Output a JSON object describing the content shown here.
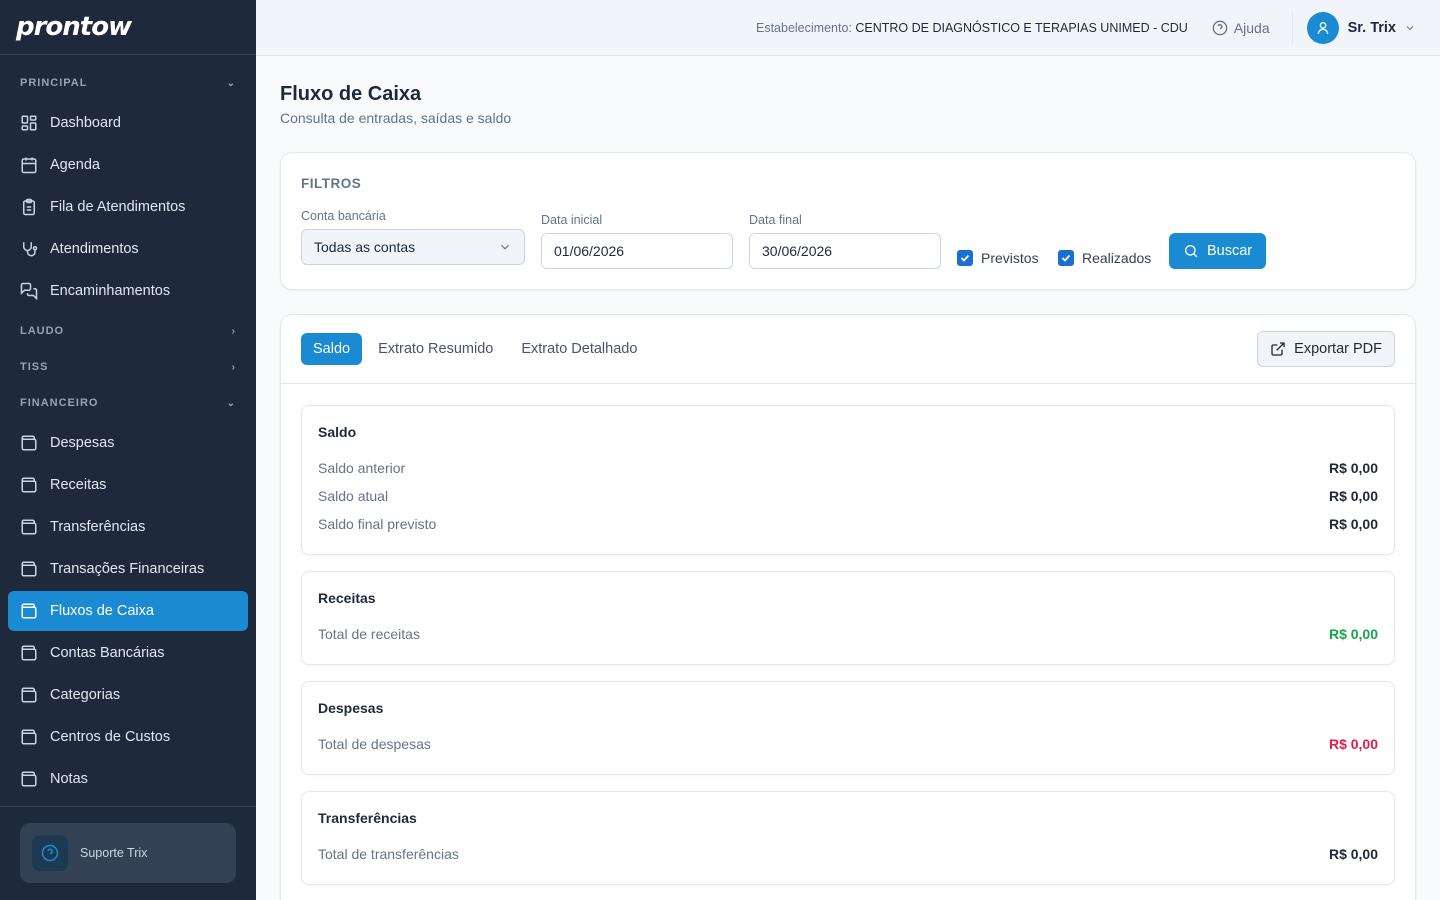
{
  "app": {
    "logo": "prontow"
  },
  "topbar": {
    "estab_label": "Estabelecimento:",
    "estab_value": "CENTRO DE DIAGNÓSTICO E TERAPIAS UNIMED - CDU",
    "help": "Ajuda",
    "user_name": "Sr. Trix"
  },
  "sidebar": {
    "sections": {
      "principal": "PRINCIPAL",
      "laudo": "LAUDO",
      "tiss": "TISS",
      "financeiro": "FINANCEIRO"
    },
    "principal_items": [
      "Dashboard",
      "Agenda",
      "Fila de Atendimentos",
      "Atendimentos",
      "Encaminhamentos"
    ],
    "financeiro_items": [
      "Despesas",
      "Receitas",
      "Transferências",
      "Transações Financeiras",
      "Fluxos de Caixa",
      "Contas Bancárias",
      "Categorias",
      "Centros de Custos",
      "Notas"
    ],
    "support": "Suporte Trix"
  },
  "page": {
    "title": "Fluxo de Caixa",
    "subtitle": "Consulta de entradas, saídas e saldo"
  },
  "filters": {
    "title": "FILTROS",
    "account_label": "Conta bancária",
    "account_value": "Todas as contas",
    "start_label": "Data inicial",
    "start_value": "01/06/2026",
    "end_label": "Data final",
    "end_value": "30/06/2026",
    "previstos": "Previstos",
    "realizados": "Realizados",
    "search": "Buscar"
  },
  "tabs": [
    "Saldo",
    "Extrato Resumido",
    "Extrato Detalhado"
  ],
  "export": "Exportar PDF",
  "saldo": {
    "title": "Saldo",
    "rows": [
      {
        "label": "Saldo anterior",
        "value": "R$ 0,00"
      },
      {
        "label": "Saldo atual",
        "value": "R$ 0,00"
      },
      {
        "label": "Saldo final previsto",
        "value": "R$ 0,00"
      }
    ]
  },
  "receitas": {
    "title": "Receitas",
    "label": "Total de receitas",
    "value": "R$ 0,00"
  },
  "despesas": {
    "title": "Despesas",
    "label": "Total de despesas",
    "value": "R$ 0,00"
  },
  "transferencias": {
    "title": "Transferências",
    "label": "Total de transferências",
    "value": "R$ 0,00"
  },
  "colors": {
    "accent": "#1a8bd3",
    "sidebar": "#1e293b",
    "positive": "#16a34a",
    "negative": "#e11d48"
  }
}
